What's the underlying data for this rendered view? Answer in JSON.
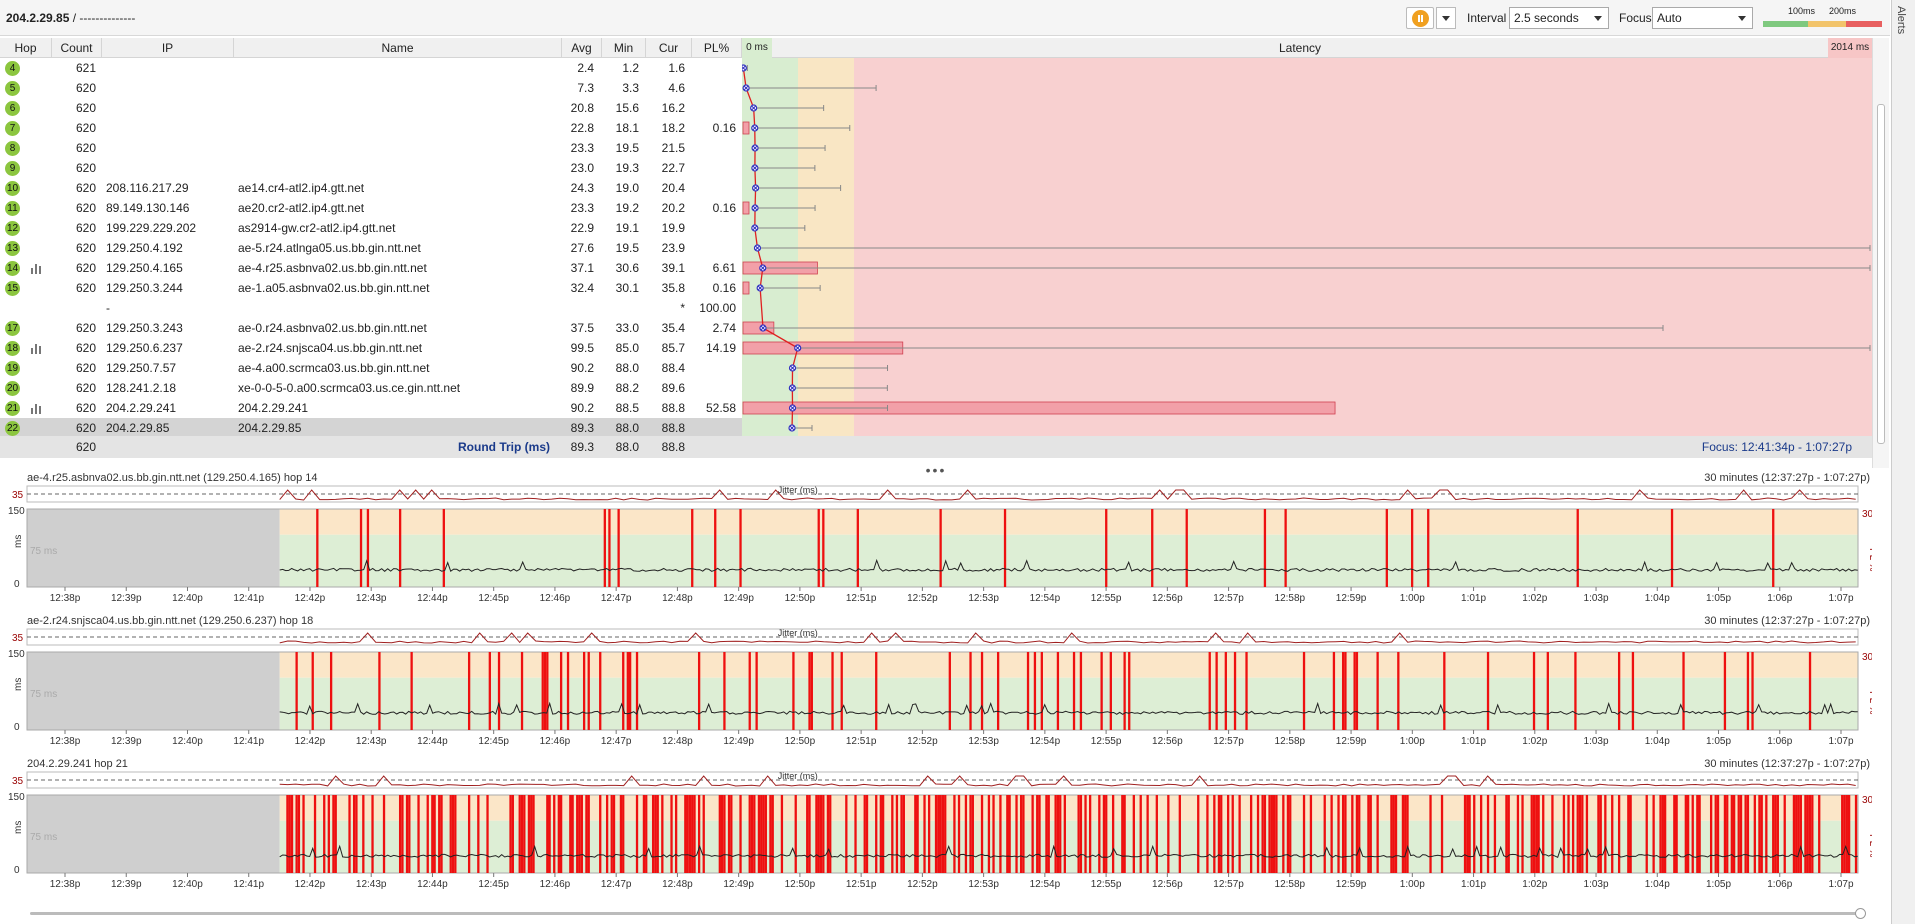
{
  "toolbar": {
    "target": "204.2.29.85",
    "target_suffix": " /   --------------",
    "interval_label": "Interval",
    "interval_value": "2.5 seconds",
    "focus_label": "Focus",
    "focus_value": "Auto",
    "scale_100": "100ms",
    "scale_200": "200ms",
    "alerts_label": "Alerts",
    "pause_icon": "pause-icon",
    "colors": {
      "good": "#7fc97f",
      "warn": "#f2c46b",
      "bad": "#e86060"
    }
  },
  "table": {
    "headers": {
      "hop": "Hop",
      "count": "Count",
      "ip": "IP",
      "name": "Name",
      "avg": "Avg",
      "min": "Min",
      "cur": "Cur",
      "pl": "PL%",
      "zero": "0 ms",
      "latency": "Latency",
      "max": "2014 ms"
    },
    "rows": [
      {
        "hop": "4",
        "count": "621",
        "ip": "",
        "name": "",
        "avg": "2.4",
        "min": "1.2",
        "cur": "1.6",
        "pl": "",
        "graph": false,
        "plv": 0,
        "lat": 2.4,
        "err": 4
      },
      {
        "hop": "5",
        "count": "620",
        "ip": "",
        "name": "",
        "avg": "7.3",
        "min": "3.3",
        "cur": "4.6",
        "pl": "",
        "graph": false,
        "plv": 0,
        "lat": 7.3,
        "err": 130
      },
      {
        "hop": "6",
        "count": "620",
        "ip": "",
        "name": "",
        "avg": "20.8",
        "min": "15.6",
        "cur": "16.2",
        "pl": "",
        "graph": false,
        "plv": 0,
        "lat": 20.8,
        "err": 70
      },
      {
        "hop": "7",
        "count": "620",
        "ip": "",
        "name": "",
        "avg": "22.8",
        "min": "18.1",
        "cur": "18.2",
        "pl": "0.16",
        "graph": false,
        "plv": 0.16,
        "lat": 22.8,
        "err": 95
      },
      {
        "hop": "8",
        "count": "620",
        "ip": "",
        "name": "",
        "avg": "23.3",
        "min": "19.5",
        "cur": "21.5",
        "pl": "",
        "graph": false,
        "plv": 0,
        "lat": 23.3,
        "err": 70
      },
      {
        "hop": "9",
        "count": "620",
        "ip": "",
        "name": "",
        "avg": "23.0",
        "min": "19.3",
        "cur": "22.7",
        "pl": "",
        "graph": false,
        "plv": 0,
        "lat": 23.0,
        "err": 60
      },
      {
        "hop": "10",
        "count": "620",
        "ip": "208.116.217.29",
        "name": "ae14.cr4-atl2.ip4.gtt.net",
        "avg": "24.3",
        "min": "19.0",
        "cur": "20.4",
        "pl": "",
        "graph": false,
        "plv": 0,
        "lat": 24.3,
        "err": 85
      },
      {
        "hop": "11",
        "count": "620",
        "ip": "89.149.130.146",
        "name": "ae20.cr2-atl2.ip4.gtt.net",
        "avg": "23.3",
        "min": "19.2",
        "cur": "20.2",
        "pl": "0.16",
        "graph": false,
        "plv": 0.16,
        "lat": 23.3,
        "err": 60
      },
      {
        "hop": "12",
        "count": "620",
        "ip": "199.229.229.202",
        "name": "as2914-gw.cr2-atl2.ip4.gtt.net",
        "avg": "22.9",
        "min": "19.1",
        "cur": "19.9",
        "pl": "",
        "graph": false,
        "plv": 0,
        "lat": 22.9,
        "err": 50
      },
      {
        "hop": "13",
        "count": "620",
        "ip": "129.250.4.192",
        "name": "ae-5.r24.atlnga05.us.bb.gin.ntt.net",
        "avg": "27.6",
        "min": "19.5",
        "cur": "23.9",
        "pl": "",
        "graph": false,
        "plv": 0,
        "lat": 27.6,
        "err": 1815
      },
      {
        "hop": "14",
        "count": "620",
        "ip": "129.250.4.165",
        "name": "ae-4.r25.asbnva02.us.bb.gin.ntt.net",
        "avg": "37.1",
        "min": "30.6",
        "cur": "39.1",
        "pl": "6.61",
        "graph": true,
        "plv": 6.61,
        "lat": 37.1,
        "err": 1690
      },
      {
        "hop": "15",
        "count": "620",
        "ip": "129.250.3.244",
        "name": "ae-1.a05.asbnva02.us.bb.gin.ntt.net",
        "avg": "32.4",
        "min": "30.1",
        "cur": "35.8",
        "pl": "0.16",
        "graph": false,
        "plv": 0.16,
        "lat": 32.4,
        "err": 60
      },
      {
        "hop": "",
        "count": "",
        "ip": "-",
        "name": "",
        "avg": "",
        "min": "",
        "cur": "*",
        "pl": "100.00",
        "graph": false,
        "plv": 0,
        "lat": null,
        "err": 0
      },
      {
        "hop": "17",
        "count": "620",
        "ip": "129.250.3.243",
        "name": "ae-0.r24.asbnva02.us.bb.gin.ntt.net",
        "avg": "37.5",
        "min": "33.0",
        "cur": "35.4",
        "pl": "2.74",
        "graph": false,
        "plv": 2.74,
        "lat": 37.5,
        "err": 900
      },
      {
        "hop": "18",
        "count": "620",
        "ip": "129.250.6.237",
        "name": "ae-2.r24.snjsca04.us.bb.gin.ntt.net",
        "avg": "99.5",
        "min": "85.0",
        "cur": "85.7",
        "pl": "14.19",
        "graph": true,
        "plv": 14.19,
        "lat": 99.5,
        "err": 1910
      },
      {
        "hop": "19",
        "count": "620",
        "ip": "129.250.7.57",
        "name": "ae-4.a00.scrmca03.us.bb.gin.ntt.net",
        "avg": "90.2",
        "min": "88.0",
        "cur": "88.4",
        "pl": "",
        "graph": false,
        "plv": 0,
        "lat": 90.2,
        "err": 95
      },
      {
        "hop": "20",
        "count": "620",
        "ip": "128.241.2.18",
        "name": "xe-0-0-5-0.a00.scrmca03.us.ce.gin.ntt.net",
        "avg": "89.9",
        "min": "88.2",
        "cur": "89.6",
        "pl": "",
        "graph": false,
        "plv": 0,
        "lat": 89.9,
        "err": 95
      },
      {
        "hop": "21",
        "count": "620",
        "ip": "204.2.29.241",
        "name": "204.2.29.241",
        "avg": "90.2",
        "min": "88.5",
        "cur": "88.8",
        "pl": "52.58",
        "graph": true,
        "plv": 52.58,
        "lat": 90.2,
        "err": 95
      },
      {
        "hop": "22",
        "count": "620",
        "ip": "204.2.29.85",
        "name": "204.2.29.85",
        "avg": "89.3",
        "min": "88.0",
        "cur": "88.8",
        "pl": "",
        "graph": false,
        "plv": 0,
        "lat": 89.3,
        "err": 20
      }
    ],
    "round_trip": {
      "count": "620",
      "label": "Round Trip (ms)",
      "avg": "89.3",
      "min": "88.0",
      "cur": "88.8"
    },
    "focus_range": "Focus: 12:41:34p - 1:07:27p"
  },
  "graphs": [
    {
      "title": "ae-4.r25.asbnva02.us.bb.gin.ntt.net (129.250.4.165) hop 14",
      "range": "30 minutes (12:37:27p - 1:07:27p)",
      "seed": 3,
      "density": 0.035
    },
    {
      "title": "ae-2.r24.snjsca04.us.bb.gin.ntt.net (129.250.6.237) hop 18",
      "range": "30 minutes (12:37:27p - 1:07:27p)",
      "seed": 7,
      "density": 0.09
    },
    {
      "title": "204.2.29.241 hop 21",
      "range": "30 minutes (12:37:27p - 1:07:27p)",
      "seed": 11,
      "density": 0.4
    }
  ],
  "graph_labels": {
    "jitter": "Jitter (ms)",
    "y35": "35",
    "y150": "150",
    "y0": "0",
    "ms": "ms",
    "y30": "30",
    "pl": "PL %",
    "mid": "75 ms",
    "times": [
      "12:38p",
      "12:39p",
      "12:40p",
      "12:41p",
      "12:42p",
      "12:43p",
      "12:44p",
      "12:45p",
      "12:46p",
      "12:47p",
      "12:48p",
      "12:49p",
      "12:50p",
      "12:51p",
      "12:52p",
      "12:53p",
      "12:54p",
      "12:55p",
      "12:56p",
      "12:57p",
      "12:58p",
      "12:59p",
      "1:00p",
      "1:01p",
      "1:02p",
      "1:03p",
      "1:04p",
      "1:05p",
      "1:06p",
      "1:07p"
    ]
  }
}
